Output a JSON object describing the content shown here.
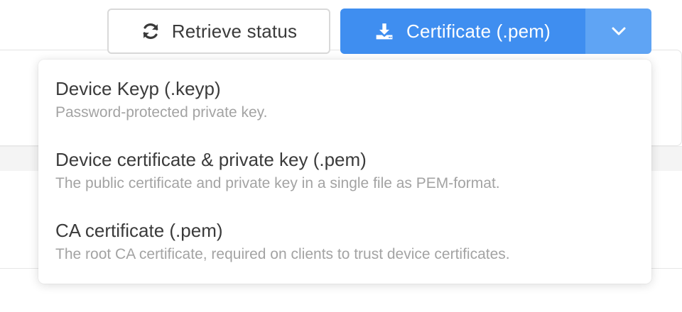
{
  "toolbar": {
    "retrieve_label": "Retrieve status",
    "retrieve_icon": "refresh-icon",
    "certificate_label": "Certificate (.pem)",
    "certificate_icon": "download-icon",
    "dropdown_icon": "chevron-down-icon"
  },
  "menu": {
    "items": [
      {
        "title": "Device Keyp (.keyp)",
        "description": "Password-protected private key."
      },
      {
        "title": "Device certificate & private key (.pem)",
        "description": "The public certificate and private key in a single file as PEM-format."
      },
      {
        "title": "CA certificate (.pem)",
        "description": "The root CA certificate, required on clients to trust device certificates."
      }
    ]
  },
  "colors": {
    "primary": "#3f8ef0",
    "primary_light": "#5fa4f4",
    "text": "#3b3b3b",
    "muted": "#a3a3a3",
    "border": "#d9d9d9"
  }
}
